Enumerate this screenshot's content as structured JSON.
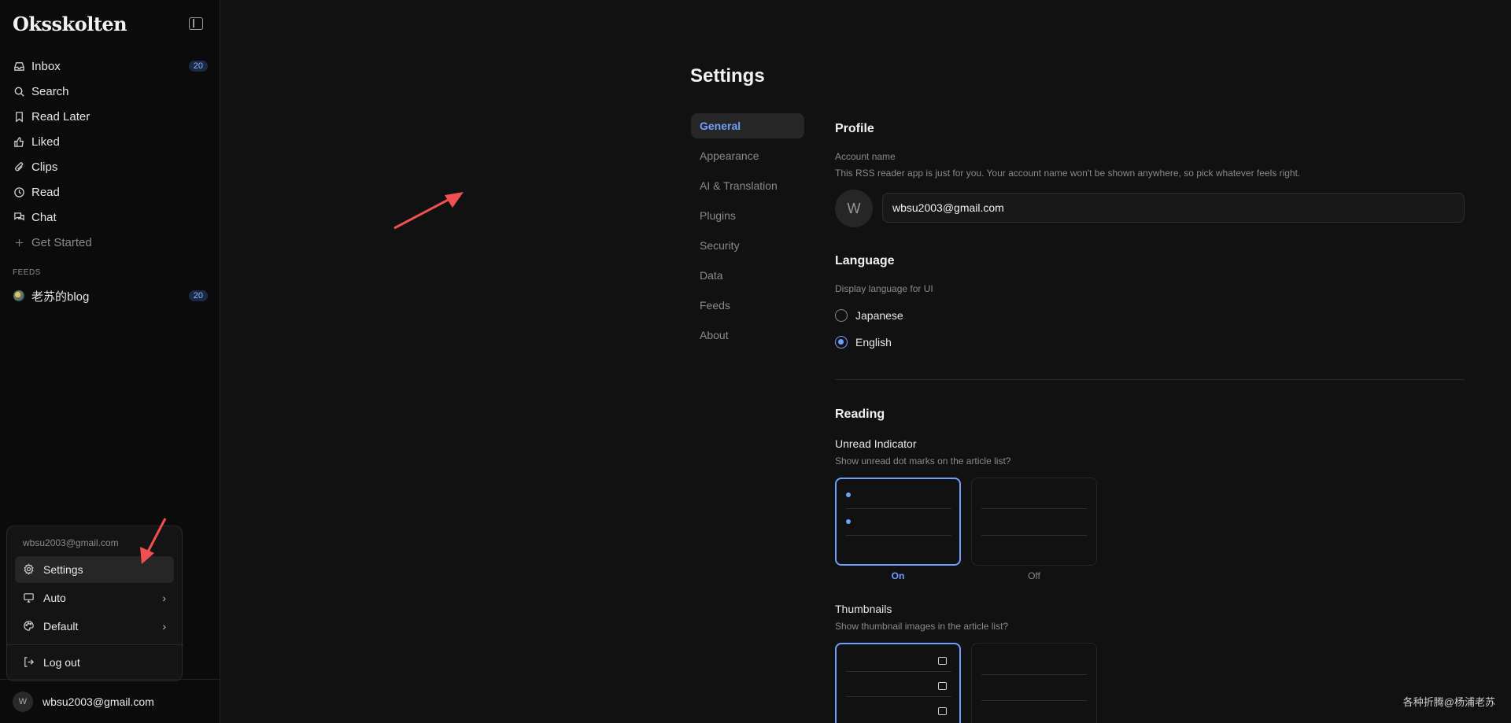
{
  "app": {
    "brand": "Oksskolten"
  },
  "sidebar": {
    "items": [
      {
        "label": "Inbox",
        "icon": "inbox-icon",
        "badge": "20"
      },
      {
        "label": "Search",
        "icon": "search-icon"
      },
      {
        "label": "Read Later",
        "icon": "bookmark-icon"
      },
      {
        "label": "Liked",
        "icon": "thumbs-up-icon"
      },
      {
        "label": "Clips",
        "icon": "paperclip-icon"
      },
      {
        "label": "Read",
        "icon": "clock-icon"
      },
      {
        "label": "Chat",
        "icon": "chat-icon"
      },
      {
        "label": "Get Started",
        "icon": "plus-icon"
      }
    ],
    "feeds_heading": "FEEDS",
    "feeds": [
      {
        "label": "老苏的blog",
        "badge": "20"
      }
    ]
  },
  "user_menu": {
    "email": "wbsu2003@gmail.com",
    "items": [
      {
        "label": "Settings",
        "icon": "gear-icon"
      },
      {
        "label": "Auto",
        "icon": "monitor-icon"
      },
      {
        "label": "Default",
        "icon": "palette-icon"
      },
      {
        "label": "Log out",
        "icon": "logout-icon"
      }
    ]
  },
  "user_bar": {
    "avatar": "W",
    "email": "wbsu2003@gmail.com"
  },
  "settings": {
    "title": "Settings",
    "nav": [
      "General",
      "Appearance",
      "AI & Translation",
      "Plugins",
      "Security",
      "Data",
      "Feeds",
      "About"
    ],
    "profile": {
      "title": "Profile",
      "account_label": "Account name",
      "account_hint": "This RSS reader app is just for you. Your account name won't be shown anywhere, so pick whatever feels right.",
      "avatar": "W",
      "account_value": "wbsu2003@gmail.com"
    },
    "language": {
      "title": "Language",
      "hint": "Display language for UI",
      "options": [
        "Japanese",
        "English"
      ],
      "selected": "English"
    },
    "reading": {
      "title": "Reading",
      "unread": {
        "title": "Unread Indicator",
        "hint": "Show unread dot marks on the article list?",
        "on": "On",
        "off": "Off"
      },
      "thumbnails": {
        "title": "Thumbnails",
        "hint": "Show thumbnail images in the article list?"
      }
    }
  },
  "watermark": "各种折腾@杨浦老苏",
  "colors": {
    "accent": "#6ea0ff",
    "annotation_arrow": "#f05050"
  }
}
